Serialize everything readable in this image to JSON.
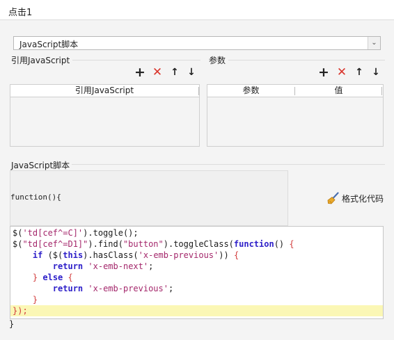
{
  "dialog": {
    "title": "点击1"
  },
  "script_type_select": {
    "selected": "JavaScript脚本"
  },
  "ref_section": {
    "title": "引用JavaScript",
    "columns": [
      "引用JavaScript"
    ]
  },
  "param_section": {
    "title": "参数",
    "columns": [
      "参数",
      "值"
    ]
  },
  "toolbar_icons": [
    "plus-icon",
    "delete-x-icon",
    "arrow-up-icon",
    "arrow-down-icon"
  ],
  "script_section": {
    "title": "JavaScript脚本",
    "function_header": "function(){",
    "format_button": "格式化代码",
    "closing_brace": "}",
    "code_lines": [
      [
        {
          "t": "$(",
          "c": "id"
        },
        {
          "t": "'td[cef^=C]'",
          "c": "str"
        },
        {
          "t": ").toggle();",
          "c": "id"
        }
      ],
      [
        {
          "t": "$(",
          "c": "id"
        },
        {
          "t": "\"td[cef^=D1]\"",
          "c": "str"
        },
        {
          "t": ").find(",
          "c": "id"
        },
        {
          "t": "\"button\"",
          "c": "str"
        },
        {
          "t": ").toggleClass(",
          "c": "id"
        },
        {
          "t": "function",
          "c": "kw"
        },
        {
          "t": "() ",
          "c": "id"
        },
        {
          "t": "{",
          "c": "br"
        }
      ],
      [
        {
          "t": "    ",
          "c": "id"
        },
        {
          "t": "if",
          "c": "kw"
        },
        {
          "t": " ($(",
          "c": "id"
        },
        {
          "t": "this",
          "c": "kw"
        },
        {
          "t": ").hasClass(",
          "c": "id"
        },
        {
          "t": "'x-emb-previous'",
          "c": "str"
        },
        {
          "t": ")) ",
          "c": "id"
        },
        {
          "t": "{",
          "c": "br"
        }
      ],
      [
        {
          "t": "        ",
          "c": "id"
        },
        {
          "t": "return",
          "c": "kw"
        },
        {
          "t": " ",
          "c": "id"
        },
        {
          "t": "'x-emb-next'",
          "c": "str"
        },
        {
          "t": ";",
          "c": "id"
        }
      ],
      [
        {
          "t": "    ",
          "c": "id"
        },
        {
          "t": "}",
          "c": "br"
        },
        {
          "t": " ",
          "c": "id"
        },
        {
          "t": "else",
          "c": "kw"
        },
        {
          "t": " ",
          "c": "id"
        },
        {
          "t": "{",
          "c": "br"
        }
      ],
      [
        {
          "t": "        ",
          "c": "id"
        },
        {
          "t": "return",
          "c": "kw"
        },
        {
          "t": " ",
          "c": "id"
        },
        {
          "t": "'x-emb-previous'",
          "c": "str"
        },
        {
          "t": ";",
          "c": "id"
        }
      ],
      [
        {
          "t": "    ",
          "c": "id"
        },
        {
          "t": "}",
          "c": "br"
        }
      ],
      [
        {
          "t": "});",
          "c": "br"
        }
      ]
    ],
    "active_line": 8
  },
  "colors": {
    "delete_icon": "#d9342b",
    "keyword": "#2e20c9",
    "string": "#a4276b",
    "bracket": "#d23c3c",
    "active_line_bg": "#fbf7b5"
  }
}
